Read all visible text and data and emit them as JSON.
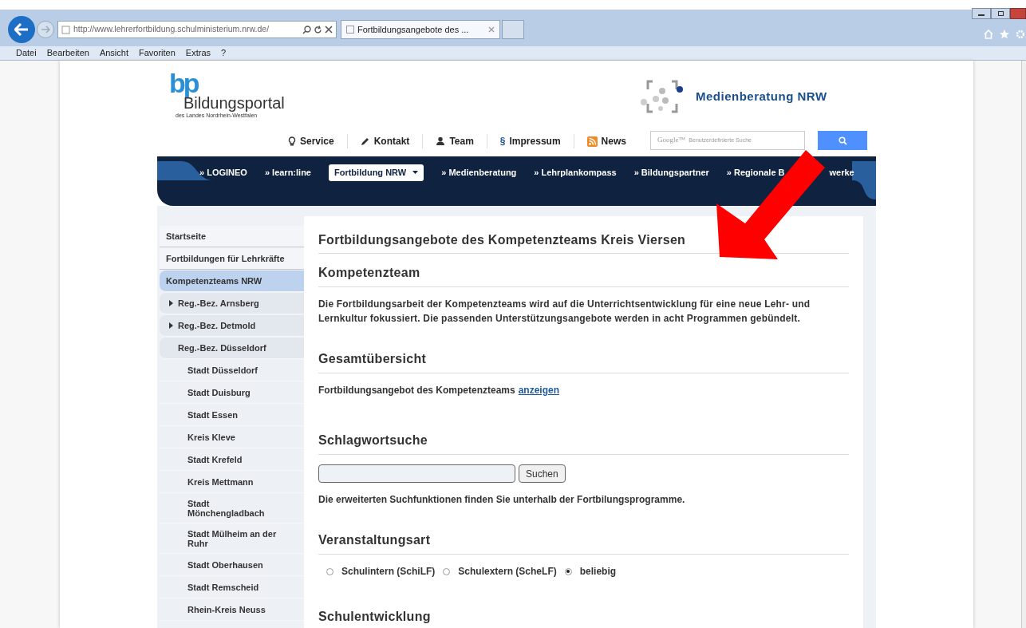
{
  "browser": {
    "address": "http://www.lehrerfortbildung.schulministerium.nrw.de/",
    "tab": {
      "title": "Fortbildungsangebote des ...",
      "selected": true
    },
    "menu": [
      "Datei",
      "Bearbeiten",
      "Ansicht",
      "Favoriten",
      "Extras",
      "?"
    ]
  },
  "header": {
    "logo_mark": "bp",
    "logo_title": "Bildungsportal",
    "logo_subtitle": "des Landes Nordrhein-Westfalen",
    "partner": "Medienberatung NRW",
    "links": [
      {
        "kind": "bulb",
        "label": "Service"
      },
      {
        "kind": "pencil",
        "label": "Kontakt"
      },
      {
        "kind": "person",
        "label": "Team"
      },
      {
        "kind": "paragraph",
        "label": "Impressum",
        "glyph": "§"
      },
      {
        "kind": "rss",
        "label": "News"
      }
    ],
    "search": {
      "placeholder": "Benutzerdefinierte Suche",
      "brand": "Google™"
    }
  },
  "nav": [
    {
      "label": "» LOGINEO",
      "selected": false
    },
    {
      "label": "» learn:line",
      "selected": false
    },
    {
      "label": "Fortbildung NRW",
      "selected": true
    },
    {
      "label": "» Medienberatung",
      "selected": false
    },
    {
      "label": "» Lehrplankompass",
      "selected": false
    },
    {
      "label": "» Bildungspartner",
      "selected": false
    },
    {
      "label": "» Regionale B",
      "label_after": "werke",
      "selected": false
    }
  ],
  "sidebar": [
    {
      "label": "Startseite",
      "selected": false
    },
    {
      "label": "Fortbildungen für Lehrkräfte",
      "selected": false
    },
    {
      "label": "Kompetenzteams NRW",
      "selected": true,
      "children": [
        {
          "label": "Reg.-Bez. Arnsberg",
          "selected": false,
          "expanded": false
        },
        {
          "label": "Reg.-Bez. Detmold",
          "selected": false,
          "expanded": false
        },
        {
          "label": "Reg.-Bez. Düsseldorf",
          "selected": false,
          "expanded": true,
          "children": [
            {
              "label": "Stadt Düsseldorf",
              "selected": false
            },
            {
              "label": "Stadt Duisburg",
              "selected": false
            },
            {
              "label": "Stadt Essen",
              "selected": false
            },
            {
              "label": "Kreis Kleve",
              "selected": false
            },
            {
              "label": "Stadt Krefeld",
              "selected": false
            },
            {
              "label": "Kreis Mettmann",
              "selected": false
            },
            {
              "label": "Stadt Mönchengladbach",
              "selected": false
            },
            {
              "label": "Stadt Mülheim an der Ruhr",
              "selected": false
            },
            {
              "label": "Stadt Oberhausen",
              "selected": false
            },
            {
              "label": "Stadt Remscheid",
              "selected": false
            },
            {
              "label": "Rhein-Kreis Neuss",
              "selected": false
            }
          ]
        }
      ]
    }
  ],
  "main": {
    "title": "Fortbildungsangebote des Kompetenzteams Kreis Viersen",
    "sections": [
      {
        "kind": "text",
        "heading": "Kompetenzteam",
        "text": "Die Fortbildungsarbeit der Kompetenzteams wird auf die Unterrichtsentwicklung für eine neue Lehr- und Lernkultur fokussiert. Die passenden Unterstützungsangebote werden in acht Programmen gebündelt."
      },
      {
        "kind": "link",
        "heading": "Gesamtübersicht",
        "text": "Fortbildungsangebot des Kompetenzteams",
        "link": "anzeigen"
      },
      {
        "kind": "search",
        "heading": "Schlagwortsuche",
        "button": "Suchen",
        "text": "Die erweiterten Suchfunktionen finden Sie unterhalb der Fortbilungsprogramme."
      },
      {
        "kind": "radios",
        "heading": "Veranstaltungsart",
        "options": [
          {
            "label": "Schulintern (SchiLF)",
            "selected": false
          },
          {
            "label": "Schulextern (ScheLF)",
            "selected": false
          },
          {
            "label": "beliebig",
            "selected": true
          }
        ]
      },
      {
        "kind": "heading",
        "heading": "Schulentwicklung"
      }
    ]
  }
}
